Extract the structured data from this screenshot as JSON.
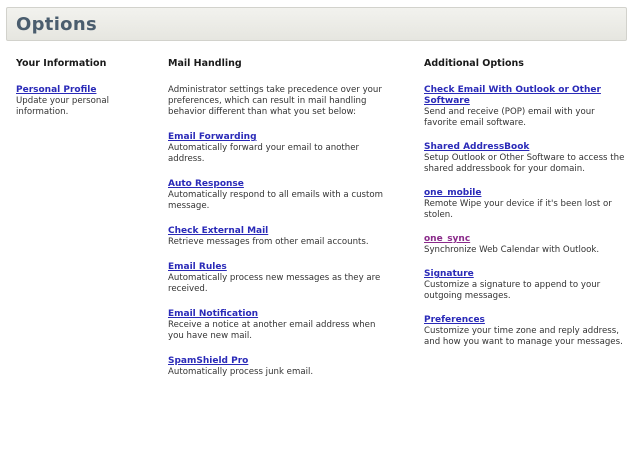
{
  "header": {
    "title": "Options"
  },
  "columns": {
    "your_information": {
      "heading": "Your Information",
      "items": [
        {
          "label": "Personal Profile",
          "description": "Update your personal information."
        }
      ]
    },
    "mail_handling": {
      "heading": "Mail Handling",
      "intro": "Administrator settings take precedence over your preferences, which can result in mail handling behavior different than what you set below:",
      "items": [
        {
          "label": "Email Forwarding",
          "description": "Automatically forward your email to another address."
        },
        {
          "label": "Auto Response",
          "description": "Automatically respond to all emails with a custom message."
        },
        {
          "label": "Check External Mail",
          "description": "Retrieve messages from other email accounts."
        },
        {
          "label": "Email Rules",
          "description": "Automatically process new messages as they are received."
        },
        {
          "label": "Email Notification",
          "description": "Receive a notice at another email address when you have new mail."
        },
        {
          "label": "SpamShield Pro",
          "description": "Automatically process junk email."
        }
      ]
    },
    "additional_options": {
      "heading": "Additional Options",
      "items": [
        {
          "label": "Check Email With Outlook or Other Software",
          "description": "Send and receive (POP) email with your favorite email software."
        },
        {
          "label": "Shared AddressBook",
          "description": "Setup Outlook or Other Software to access the shared addressbook for your domain."
        },
        {
          "label": "one_mobile",
          "description": "Remote Wipe your device if it's been lost or stolen."
        },
        {
          "label": "one_sync",
          "description": "Synchronize Web Calendar with Outlook."
        },
        {
          "label": "Signature",
          "description": "Customize a signature to append to your outgoing messages."
        },
        {
          "label": "Preferences",
          "description": "Customize your time zone and reply address, and how you want to manage your messages."
        }
      ]
    }
  },
  "colors": {
    "link": "#2a2ab8",
    "visited_link": "#8a2a8a",
    "header_title": "#4a5d6e"
  }
}
